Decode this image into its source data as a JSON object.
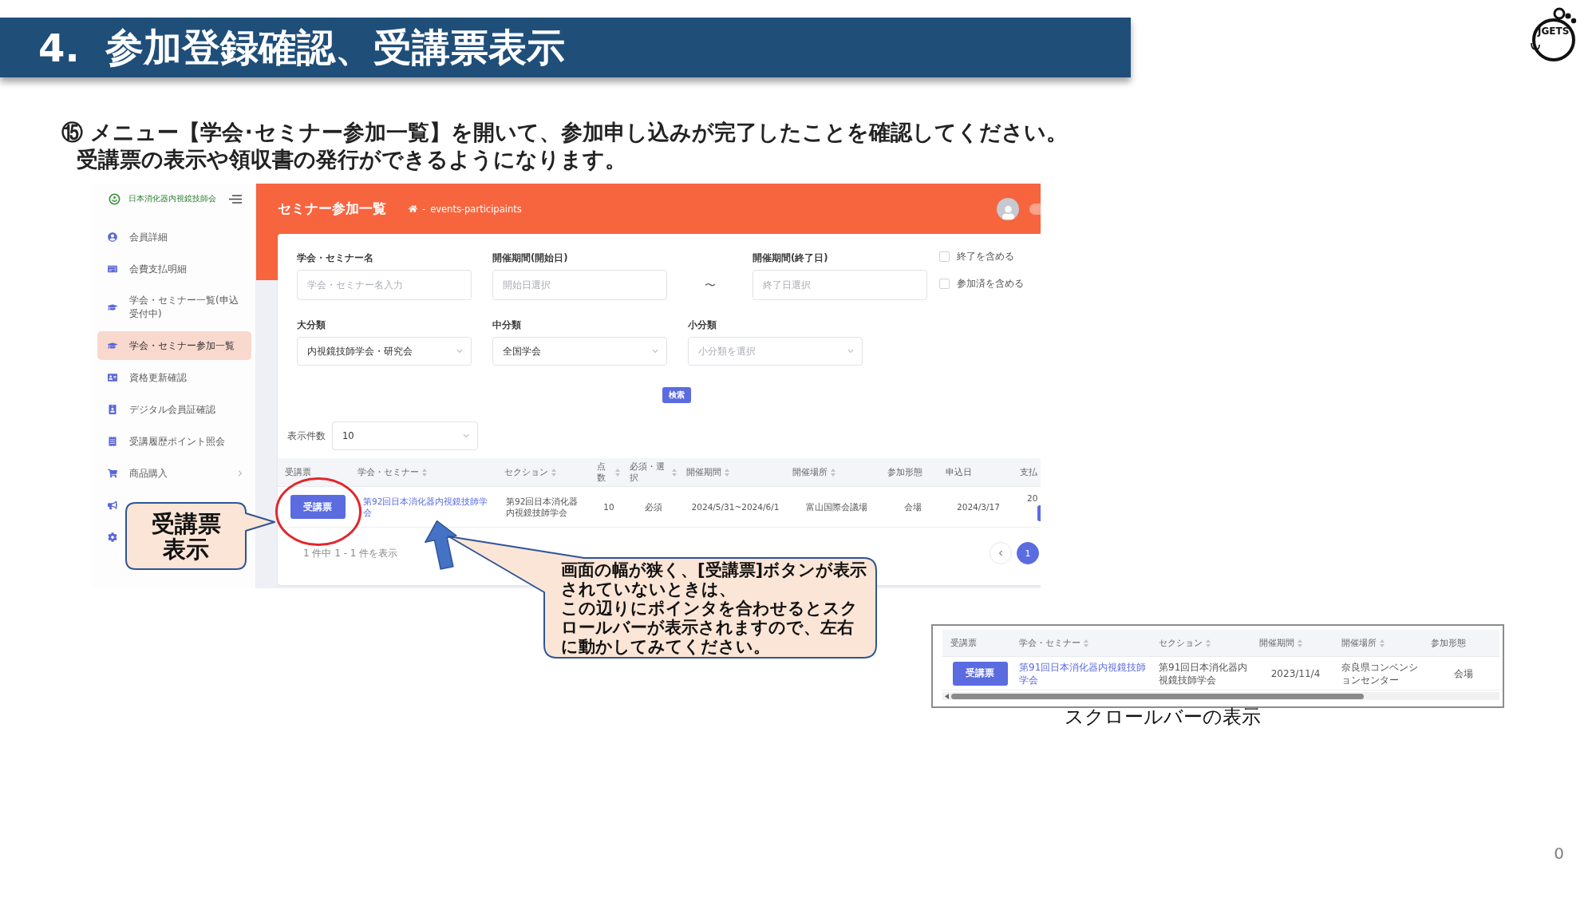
{
  "slide": {
    "title_number": "4.",
    "title": "参加登録確認、受講票表示",
    "logo_text": "JGETS",
    "instructions": [
      "⑮ メニュー【学会･セミナー参加一覧】を開いて、参加申し込みが完了したことを確認してください。",
      "受講票の表示や領収書の発行ができるようになります。"
    ],
    "page_number": "0"
  },
  "app": {
    "sidebar": {
      "org_name": "日本消化器内視鏡技師会",
      "items": [
        {
          "label": "会員詳細",
          "selected": false,
          "submenu": false
        },
        {
          "label": "会費支払明細",
          "selected": false,
          "submenu": false
        },
        {
          "label": "学会・セミナー一覧(申込受付中)",
          "selected": false,
          "submenu": false
        },
        {
          "label": "学会・セミナー参加一覧",
          "selected": true,
          "submenu": false
        },
        {
          "label": "資格更新確認",
          "selected": false,
          "submenu": false
        },
        {
          "label": "デジタル会員証確認",
          "selected": false,
          "submenu": false
        },
        {
          "label": "受講履歴ポイント照会",
          "selected": false,
          "submenu": false
        },
        {
          "label": "商品購入",
          "selected": false,
          "submenu": true
        },
        {
          "selected": false
        },
        {
          "selected": false
        }
      ]
    },
    "header": {
      "title": "セミナー参加一覧",
      "breadcrumb_separator": "-",
      "breadcrumb": "events-participaints"
    },
    "filters": {
      "row_1": [
        {
          "kind": "input",
          "label": "学会・セミナー名",
          "placeholder": "学会・セミナー名入力"
        },
        {
          "kind": "input",
          "label": "開催期間(開始日)",
          "placeholder": "開始日選択"
        },
        {
          "kind": "separator",
          "text": "〜"
        },
        {
          "kind": "input",
          "label": "開催期間(終了日)",
          "placeholder": "終了日選択"
        }
      ],
      "checkboxes": [
        {
          "label": "終了を含める",
          "checked": false
        },
        {
          "label": "参加済を含める",
          "checked": false
        }
      ],
      "row_2": [
        {
          "kind": "select",
          "label": "大分類",
          "value": "内視鏡技師学会・研究会"
        },
        {
          "kind": "select",
          "label": "中分類",
          "value": "全国学会"
        },
        {
          "kind": "select",
          "label": "小分類",
          "placeholder": "小分類を選択"
        }
      ],
      "search_button": "検索"
    },
    "page_size": {
      "label": "表示件数",
      "value": "10"
    },
    "table": {
      "columns": [
        {
          "label": "受講票",
          "sortable": false
        },
        {
          "label": "学会・セミナー",
          "sortable": true
        },
        {
          "label": "セクション",
          "sortable": true
        },
        {
          "label": "点数",
          "sortable": true
        },
        {
          "label": "必須・選択",
          "sortable": true
        },
        {
          "label": "開催期間",
          "sortable": true
        },
        {
          "label": "開催場所",
          "sortable": true
        },
        {
          "label": "参加形態",
          "sortable": false
        },
        {
          "label": "申込日",
          "sortable": false
        },
        {
          "label": "支払",
          "sortable": false
        }
      ],
      "rows": [
        {
          "cells": [
            {
              "kind": "button",
              "text": "受講票"
            },
            {
              "kind": "link",
              "text": "第92回日本消化器内視鏡技師学会"
            },
            {
              "kind": "text",
              "text": "第92回日本消化器内視鏡技師学会"
            },
            {
              "kind": "text",
              "text": "10"
            },
            {
              "kind": "text",
              "text": "必須"
            },
            {
              "kind": "text",
              "text": "2024/5/31~2024/6/1"
            },
            {
              "kind": "text",
              "text": "富山国際会議場"
            },
            {
              "kind": "text",
              "text": "会場"
            },
            {
              "kind": "text",
              "text": "2024/3/17"
            },
            {
              "kind": "partial",
              "text": "20"
            }
          ]
        }
      ]
    },
    "footer": {
      "summary": "1 件中 1 - 1 件を表示",
      "pages": [
        {
          "label": "1",
          "selected": true
        }
      ]
    }
  },
  "annotations": {
    "callouts": [
      {
        "paragraphs": [
          "受講票表示"
        ]
      },
      {
        "paragraphs": [
          "画面の幅が狭く、[受講票]ボタンが表示されていないときは、",
          "この辺りにポインタを合わせるとスクロールバーが表示されますので、左右に動かしてみてください。"
        ]
      }
    ]
  },
  "inset": {
    "columns": [
      {
        "label": "受講票",
        "sortable": false
      },
      {
        "label": "学会・セミナー",
        "sortable": true
      },
      {
        "label": "セクション",
        "sortable": true
      },
      {
        "label": "開催期間",
        "sortable": true
      },
      {
        "label": "開催場所",
        "sortable": true
      },
      {
        "label": "参加形態",
        "sortable": false
      }
    ],
    "row": [
      {
        "kind": "button",
        "text": "受講票"
      },
      {
        "kind": "link",
        "text": "第91回日本消化器内視鏡技師学会"
      },
      {
        "kind": "text",
        "text": "第91回日本消化器内視鏡技師学会"
      },
      {
        "kind": "text",
        "text": "2023/11/4"
      },
      {
        "kind": "text",
        "text": "奈良県コンベンションセンター"
      },
      {
        "kind": "text",
        "text": "会場"
      }
    ],
    "caption": "スクロールバーの表示"
  }
}
